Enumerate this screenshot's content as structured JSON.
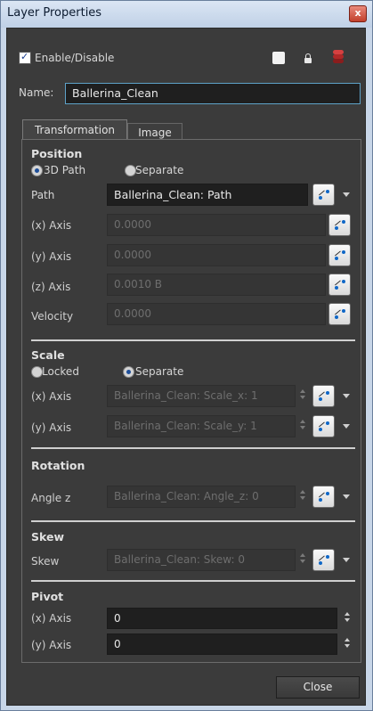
{
  "window": {
    "title": "Layer Properties",
    "close_glyph": "x"
  },
  "header": {
    "enable_label": "Enable/Disable",
    "name_label": "Name:",
    "name_value": "Ballerina_Clean"
  },
  "tabs": [
    {
      "label": "Transformation",
      "active": true
    },
    {
      "label": "Image",
      "active": false
    }
  ],
  "position": {
    "title": "Position",
    "radio_3d": "3D Path",
    "radio_separate": "Separate",
    "selected": "3D Path",
    "path_label": "Path",
    "path_value": "Ballerina_Clean: Path",
    "x_label": "(x) Axis",
    "x_value": "0.0000",
    "y_label": "(y) Axis",
    "y_value": "0.0000",
    "z_label": "(z) Axis",
    "z_value": "0.0010 B",
    "velocity_label": "Velocity",
    "velocity_value": "0.0000"
  },
  "scale": {
    "title": "Scale",
    "radio_locked": "Locked",
    "radio_separate": "Separate",
    "selected": "Separate",
    "x_label": "(x) Axis",
    "x_value": "Ballerina_Clean: Scale_x: 1",
    "y_label": "(y) Axis",
    "y_value": "Ballerina_Clean: Scale_y: 1"
  },
  "rotation": {
    "title": "Rotation",
    "angle_label": "Angle z",
    "angle_value": "Ballerina_Clean: Angle_z: 0"
  },
  "skew": {
    "title": "Skew",
    "skew_label": "Skew",
    "skew_value": "Ballerina_Clean: Skew: 0"
  },
  "pivot": {
    "title": "Pivot",
    "x_label": "(x) Axis",
    "x_value": "0",
    "y_label": "(y) Axis",
    "y_value": "0"
  },
  "footer": {
    "close_label": "Close"
  },
  "colors": {
    "panel_bg": "#3b3b3b",
    "field_bg": "#1f1f1f",
    "focus_border": "#5ea2c8"
  }
}
